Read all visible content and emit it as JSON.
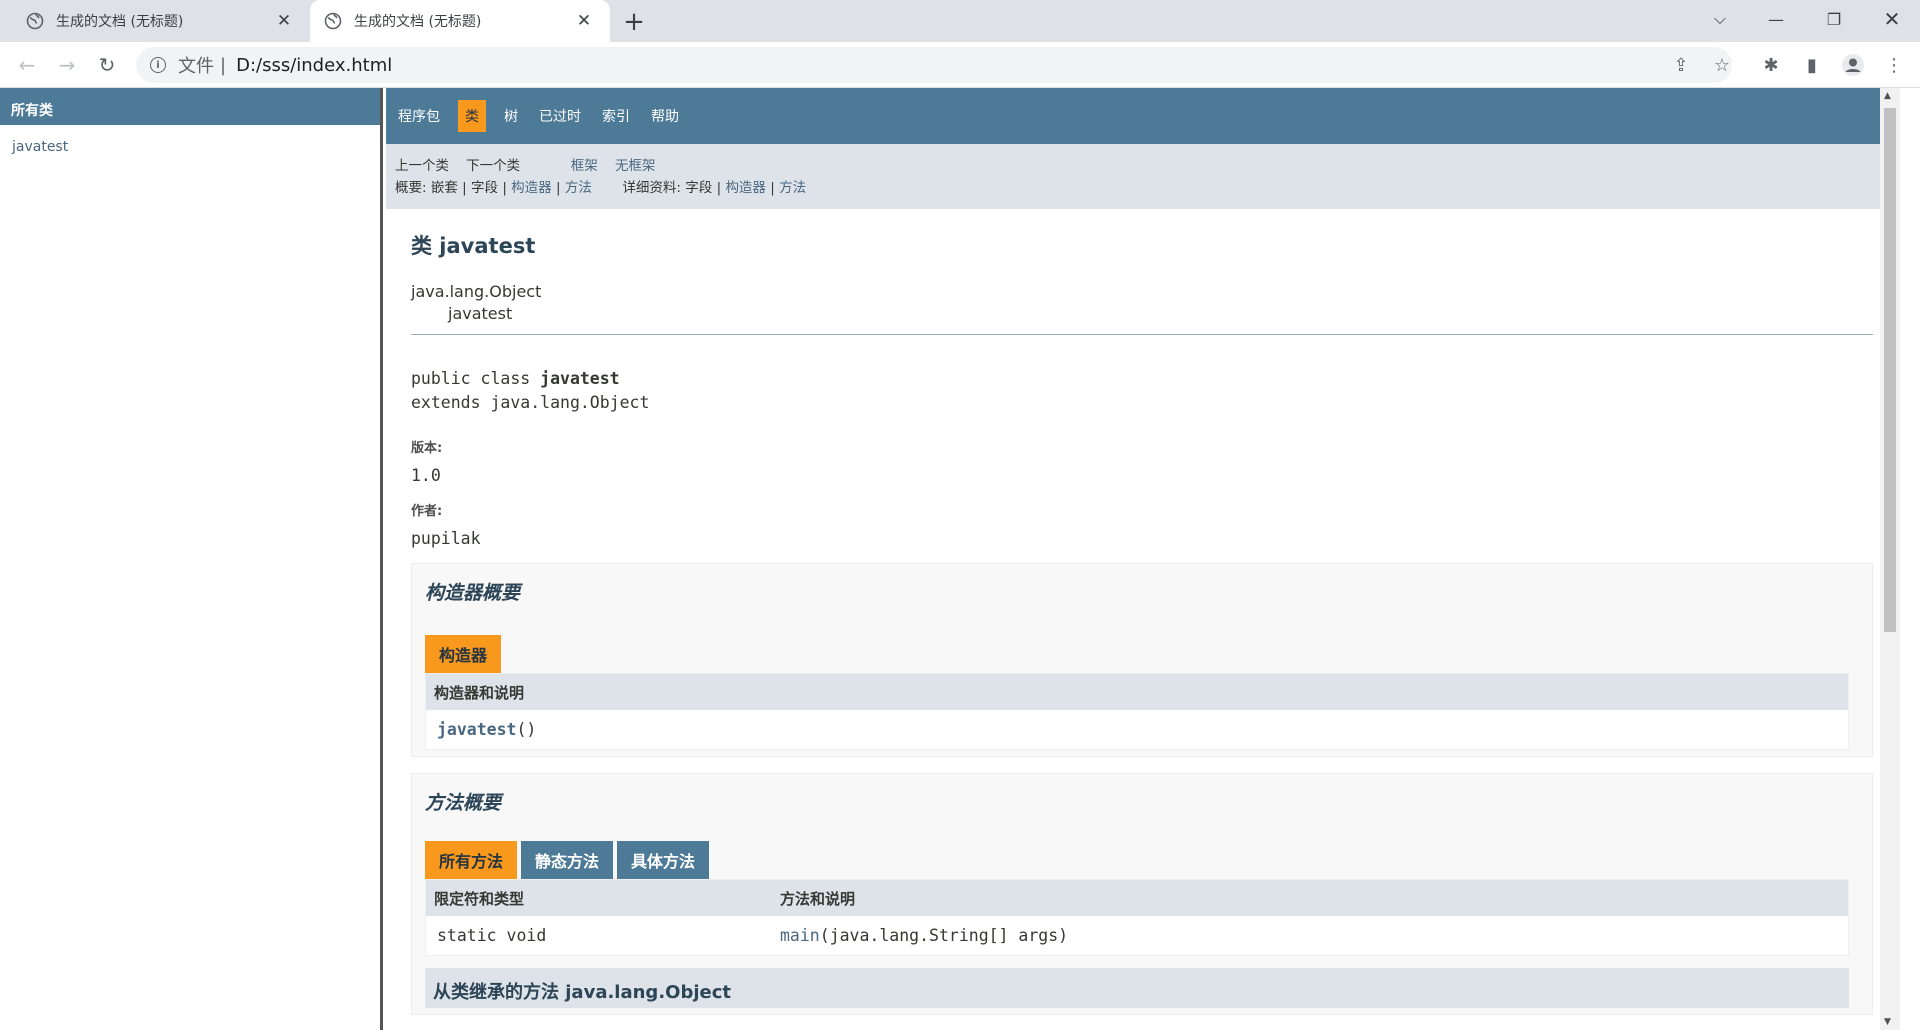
{
  "browser": {
    "tabs": [
      {
        "title": "生成的文档 (无标题)",
        "active": false
      },
      {
        "title": "生成的文档 (无标题)",
        "active": true
      }
    ],
    "omnibox": {
      "scheme_label": "文件",
      "separator": "|",
      "url": "D:/sss/index.html"
    }
  },
  "left_frame": {
    "header": "所有类",
    "items": [
      "javatest"
    ]
  },
  "topnav": {
    "items": [
      "程序包",
      "类",
      "树",
      "已过时",
      "索引",
      "帮助"
    ],
    "selected_index": 1
  },
  "subnav": {
    "prev_class": "上一个类",
    "next_class": "下一个类",
    "frames": "框架",
    "no_frames": "无框架",
    "summary_label": "概要:",
    "summary_nested": "嵌套",
    "summary_field": "字段",
    "summary_constructor": "构造器",
    "summary_method": "方法",
    "detail_label": "详细资料:",
    "detail_field": "字段",
    "detail_constructor": "构造器",
    "detail_method": "方法",
    "sep": "|"
  },
  "class_doc": {
    "title": "类 javatest",
    "inheritance": [
      "java.lang.Object",
      "javatest"
    ],
    "decl_prefix": "public class ",
    "decl_name": "javatest",
    "decl_extends": "extends java.lang.Object",
    "version_label": "版本:",
    "version_value": "1.0",
    "author_label": "作者:",
    "author_value": "pupilak"
  },
  "constructor_summary": {
    "heading": "构造器概要",
    "caption": "构造器",
    "column": "构造器和说明",
    "rows": [
      {
        "name": "javatest",
        "params": "()"
      }
    ]
  },
  "method_summary": {
    "heading": "方法概要",
    "captions": [
      "所有方法",
      "静态方法",
      "具体方法"
    ],
    "columns": [
      "限定符和类型",
      "方法和说明"
    ],
    "rows": [
      {
        "type": "static void",
        "name": "main",
        "params": "(java.lang.String[] args)"
      }
    ],
    "inherited_heading": "从类继承的方法 java.lang.Object"
  }
}
